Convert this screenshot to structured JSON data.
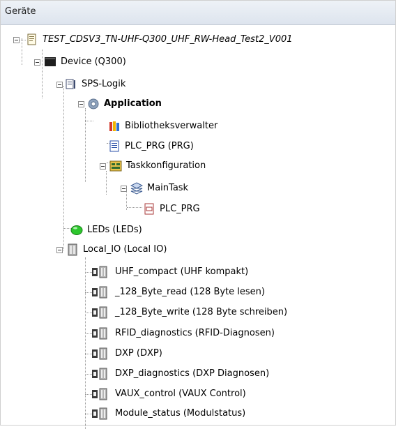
{
  "panel": {
    "title": "Geräte"
  },
  "tree": {
    "project": "TEST_CDSV3_TN-UHF-Q300_UHF_RW-Head_Test2_V001",
    "device": "Device (Q300)",
    "sps_logic": "SPS-Logik",
    "application": "Application",
    "library_manager": "Bibliotheksverwalter",
    "plc_prg": "PLC_PRG (PRG)",
    "task_config": "Taskkonfiguration",
    "main_task": "MainTask",
    "main_task_plc_prg": "PLC_PRG",
    "leds": "LEDs (LEDs)",
    "local_io": "Local_IO (Local IO)",
    "io_modules": [
      "UHF_compact (UHF kompakt)",
      "_128_Byte_read (128 Byte lesen)",
      "_128_Byte_write (128 Byte schreiben)",
      "RFID_diagnostics (RFID-Diagnosen)",
      "DXP (DXP)",
      "DXP_diagnostics (DXP Diagnosen)",
      "VAUX_control (VAUX Control)",
      "Module_status (Modulstatus)"
    ]
  }
}
